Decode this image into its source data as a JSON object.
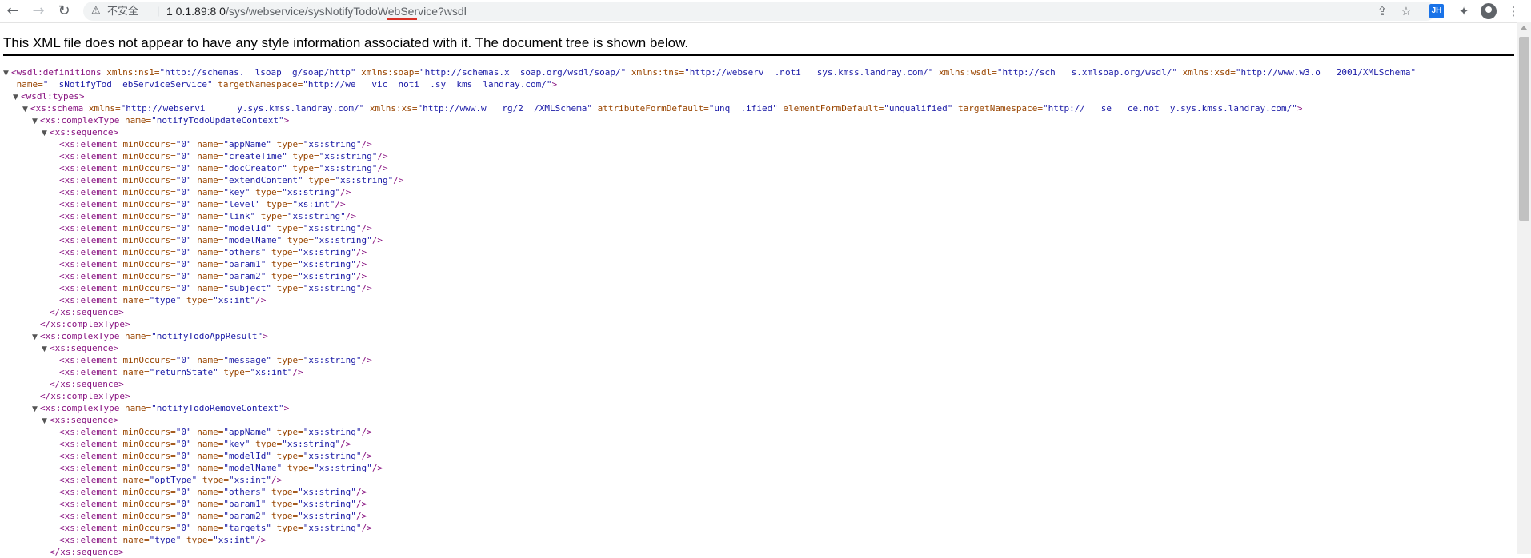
{
  "browser": {
    "security_label": "不安全",
    "url_host": "1   0.1.89:8  0",
    "url_path": "/sys/webservice/sysNotifyTodoWebService?wsdl",
    "profile_badge": "JH"
  },
  "banner": {
    "text": "This XML file does not appear to have any style information associated with it. The document tree is shown below."
  },
  "xml_lines": [
    {
      "indent": 0,
      "tri": "▼",
      "text": "<wsdl:definitions xmlns:ns1=\"http://schemas.  lsoap  g/soap/http\" xmlns:soap=\"http://schemas.x  soap.org/wsdl/soap/\" xmlns:tns=\"http://webserv  .noti   sys.kmss.landray.com/\" xmlns:wsdl=\"http://sch   s.xmlsoap.org/wsdl/\" xmlns:xsd=\"http://www.w3.o   2001/XMLSchema\""
    },
    {
      "indent": 0,
      "tri": "",
      "text": " name=\"  sNotifyTod  ebServiceService\" targetNamespace=\"http://we   vic  noti  .sy  kms  landray.com/\">"
    },
    {
      "indent": 1,
      "tri": "▼",
      "text": "<wsdl:types>"
    },
    {
      "indent": 2,
      "tri": "▼",
      "text": "<xs:schema xmlns=\"http://webservi      y.sys.kmss.landray.com/\" xmlns:xs=\"http://www.w   rg/2  /XMLSchema\" attributeFormDefault=\"unq  .ified\" elementFormDefault=\"unqualified\" targetNamespace=\"http://   se   ce.not  y.sys.kmss.landray.com/\">"
    },
    {
      "indent": 3,
      "tri": "▼",
      "text": "<xs:complexType name=\"notifyTodoUpdateContext\">"
    },
    {
      "indent": 4,
      "tri": "▼",
      "text": "<xs:sequence>"
    },
    {
      "indent": 5,
      "tri": "",
      "text": "<xs:element minOccurs=\"0\" name=\"appName\" type=\"xs:string\"/>"
    },
    {
      "indent": 5,
      "tri": "",
      "text": "<xs:element minOccurs=\"0\" name=\"createTime\" type=\"xs:string\"/>"
    },
    {
      "indent": 5,
      "tri": "",
      "text": "<xs:element minOccurs=\"0\" name=\"docCreator\" type=\"xs:string\"/>"
    },
    {
      "indent": 5,
      "tri": "",
      "text": "<xs:element minOccurs=\"0\" name=\"extendContent\" type=\"xs:string\"/>"
    },
    {
      "indent": 5,
      "tri": "",
      "text": "<xs:element minOccurs=\"0\" name=\"key\" type=\"xs:string\"/>"
    },
    {
      "indent": 5,
      "tri": "",
      "text": "<xs:element minOccurs=\"0\" name=\"level\" type=\"xs:int\"/>"
    },
    {
      "indent": 5,
      "tri": "",
      "text": "<xs:element minOccurs=\"0\" name=\"link\" type=\"xs:string\"/>"
    },
    {
      "indent": 5,
      "tri": "",
      "text": "<xs:element minOccurs=\"0\" name=\"modelId\" type=\"xs:string\"/>"
    },
    {
      "indent": 5,
      "tri": "",
      "text": "<xs:element minOccurs=\"0\" name=\"modelName\" type=\"xs:string\"/>"
    },
    {
      "indent": 5,
      "tri": "",
      "text": "<xs:element minOccurs=\"0\" name=\"others\" type=\"xs:string\"/>"
    },
    {
      "indent": 5,
      "tri": "",
      "text": "<xs:element minOccurs=\"0\" name=\"param1\" type=\"xs:string\"/>"
    },
    {
      "indent": 5,
      "tri": "",
      "text": "<xs:element minOccurs=\"0\" name=\"param2\" type=\"xs:string\"/>"
    },
    {
      "indent": 5,
      "tri": "",
      "text": "<xs:element minOccurs=\"0\" name=\"subject\" type=\"xs:string\"/>"
    },
    {
      "indent": 5,
      "tri": "",
      "text": "<xs:element name=\"type\" type=\"xs:int\"/>"
    },
    {
      "indent": 4,
      "tri": "",
      "text": "</xs:sequence>"
    },
    {
      "indent": 3,
      "tri": "",
      "text": "</xs:complexType>"
    },
    {
      "indent": 3,
      "tri": "▼",
      "text": "<xs:complexType name=\"notifyTodoAppResult\">"
    },
    {
      "indent": 4,
      "tri": "▼",
      "text": "<xs:sequence>"
    },
    {
      "indent": 5,
      "tri": "",
      "text": "<xs:element minOccurs=\"0\" name=\"message\" type=\"xs:string\"/>"
    },
    {
      "indent": 5,
      "tri": "",
      "text": "<xs:element name=\"returnState\" type=\"xs:int\"/>"
    },
    {
      "indent": 4,
      "tri": "",
      "text": "</xs:sequence>"
    },
    {
      "indent": 3,
      "tri": "",
      "text": "</xs:complexType>"
    },
    {
      "indent": 3,
      "tri": "▼",
      "text": "<xs:complexType name=\"notifyTodoRemoveContext\">"
    },
    {
      "indent": 4,
      "tri": "▼",
      "text": "<xs:sequence>"
    },
    {
      "indent": 5,
      "tri": "",
      "text": "<xs:element minOccurs=\"0\" name=\"appName\" type=\"xs:string\"/>"
    },
    {
      "indent": 5,
      "tri": "",
      "text": "<xs:element minOccurs=\"0\" name=\"key\" type=\"xs:string\"/>"
    },
    {
      "indent": 5,
      "tri": "",
      "text": "<xs:element minOccurs=\"0\" name=\"modelId\" type=\"xs:string\"/>"
    },
    {
      "indent": 5,
      "tri": "",
      "text": "<xs:element minOccurs=\"0\" name=\"modelName\" type=\"xs:string\"/>"
    },
    {
      "indent": 5,
      "tri": "",
      "text": "<xs:element name=\"optType\" type=\"xs:int\"/>"
    },
    {
      "indent": 5,
      "tri": "",
      "text": "<xs:element minOccurs=\"0\" name=\"others\" type=\"xs:string\"/>"
    },
    {
      "indent": 5,
      "tri": "",
      "text": "<xs:element minOccurs=\"0\" name=\"param1\" type=\"xs:string\"/>"
    },
    {
      "indent": 5,
      "tri": "",
      "text": "<xs:element minOccurs=\"0\" name=\"param2\" type=\"xs:string\"/>"
    },
    {
      "indent": 5,
      "tri": "",
      "text": "<xs:element minOccurs=\"0\" name=\"targets\" type=\"xs:string\"/>"
    },
    {
      "indent": 5,
      "tri": "",
      "text": "<xs:element name=\"type\" type=\"xs:int\"/>"
    },
    {
      "indent": 4,
      "tri": "",
      "text": "</xs:sequence>"
    }
  ]
}
